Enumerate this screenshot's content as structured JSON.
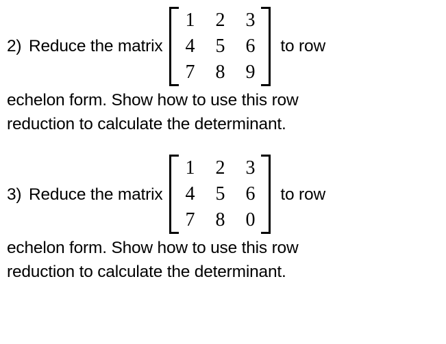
{
  "problems": [
    {
      "number": "2)",
      "lead": "Reduce the matrix",
      "trail": "to row",
      "matrix": {
        "rows": [
          [
            "1",
            "2",
            "3"
          ],
          [
            "4",
            "5",
            "6"
          ],
          [
            "7",
            "8",
            "9"
          ]
        ]
      },
      "follow1": "echelon form.  Show how to use this row",
      "follow2": "reduction to calculate the determinant."
    },
    {
      "number": "3)",
      "lead": "Reduce the matrix",
      "trail": "to row",
      "matrix": {
        "rows": [
          [
            "1",
            "2",
            "3"
          ],
          [
            "4",
            "5",
            "6"
          ],
          [
            "7",
            "8",
            "0"
          ]
        ]
      },
      "follow1": "echelon form.  Show how to use this row",
      "follow2": "reduction to calculate the determinant."
    }
  ],
  "chart_data": [
    {
      "type": "table",
      "title": "Matrix for problem 2",
      "rows": [
        [
          1,
          2,
          3
        ],
        [
          4,
          5,
          6
        ],
        [
          7,
          8,
          9
        ]
      ]
    },
    {
      "type": "table",
      "title": "Matrix for problem 3",
      "rows": [
        [
          1,
          2,
          3
        ],
        [
          4,
          5,
          6
        ],
        [
          7,
          8,
          0
        ]
      ]
    }
  ]
}
